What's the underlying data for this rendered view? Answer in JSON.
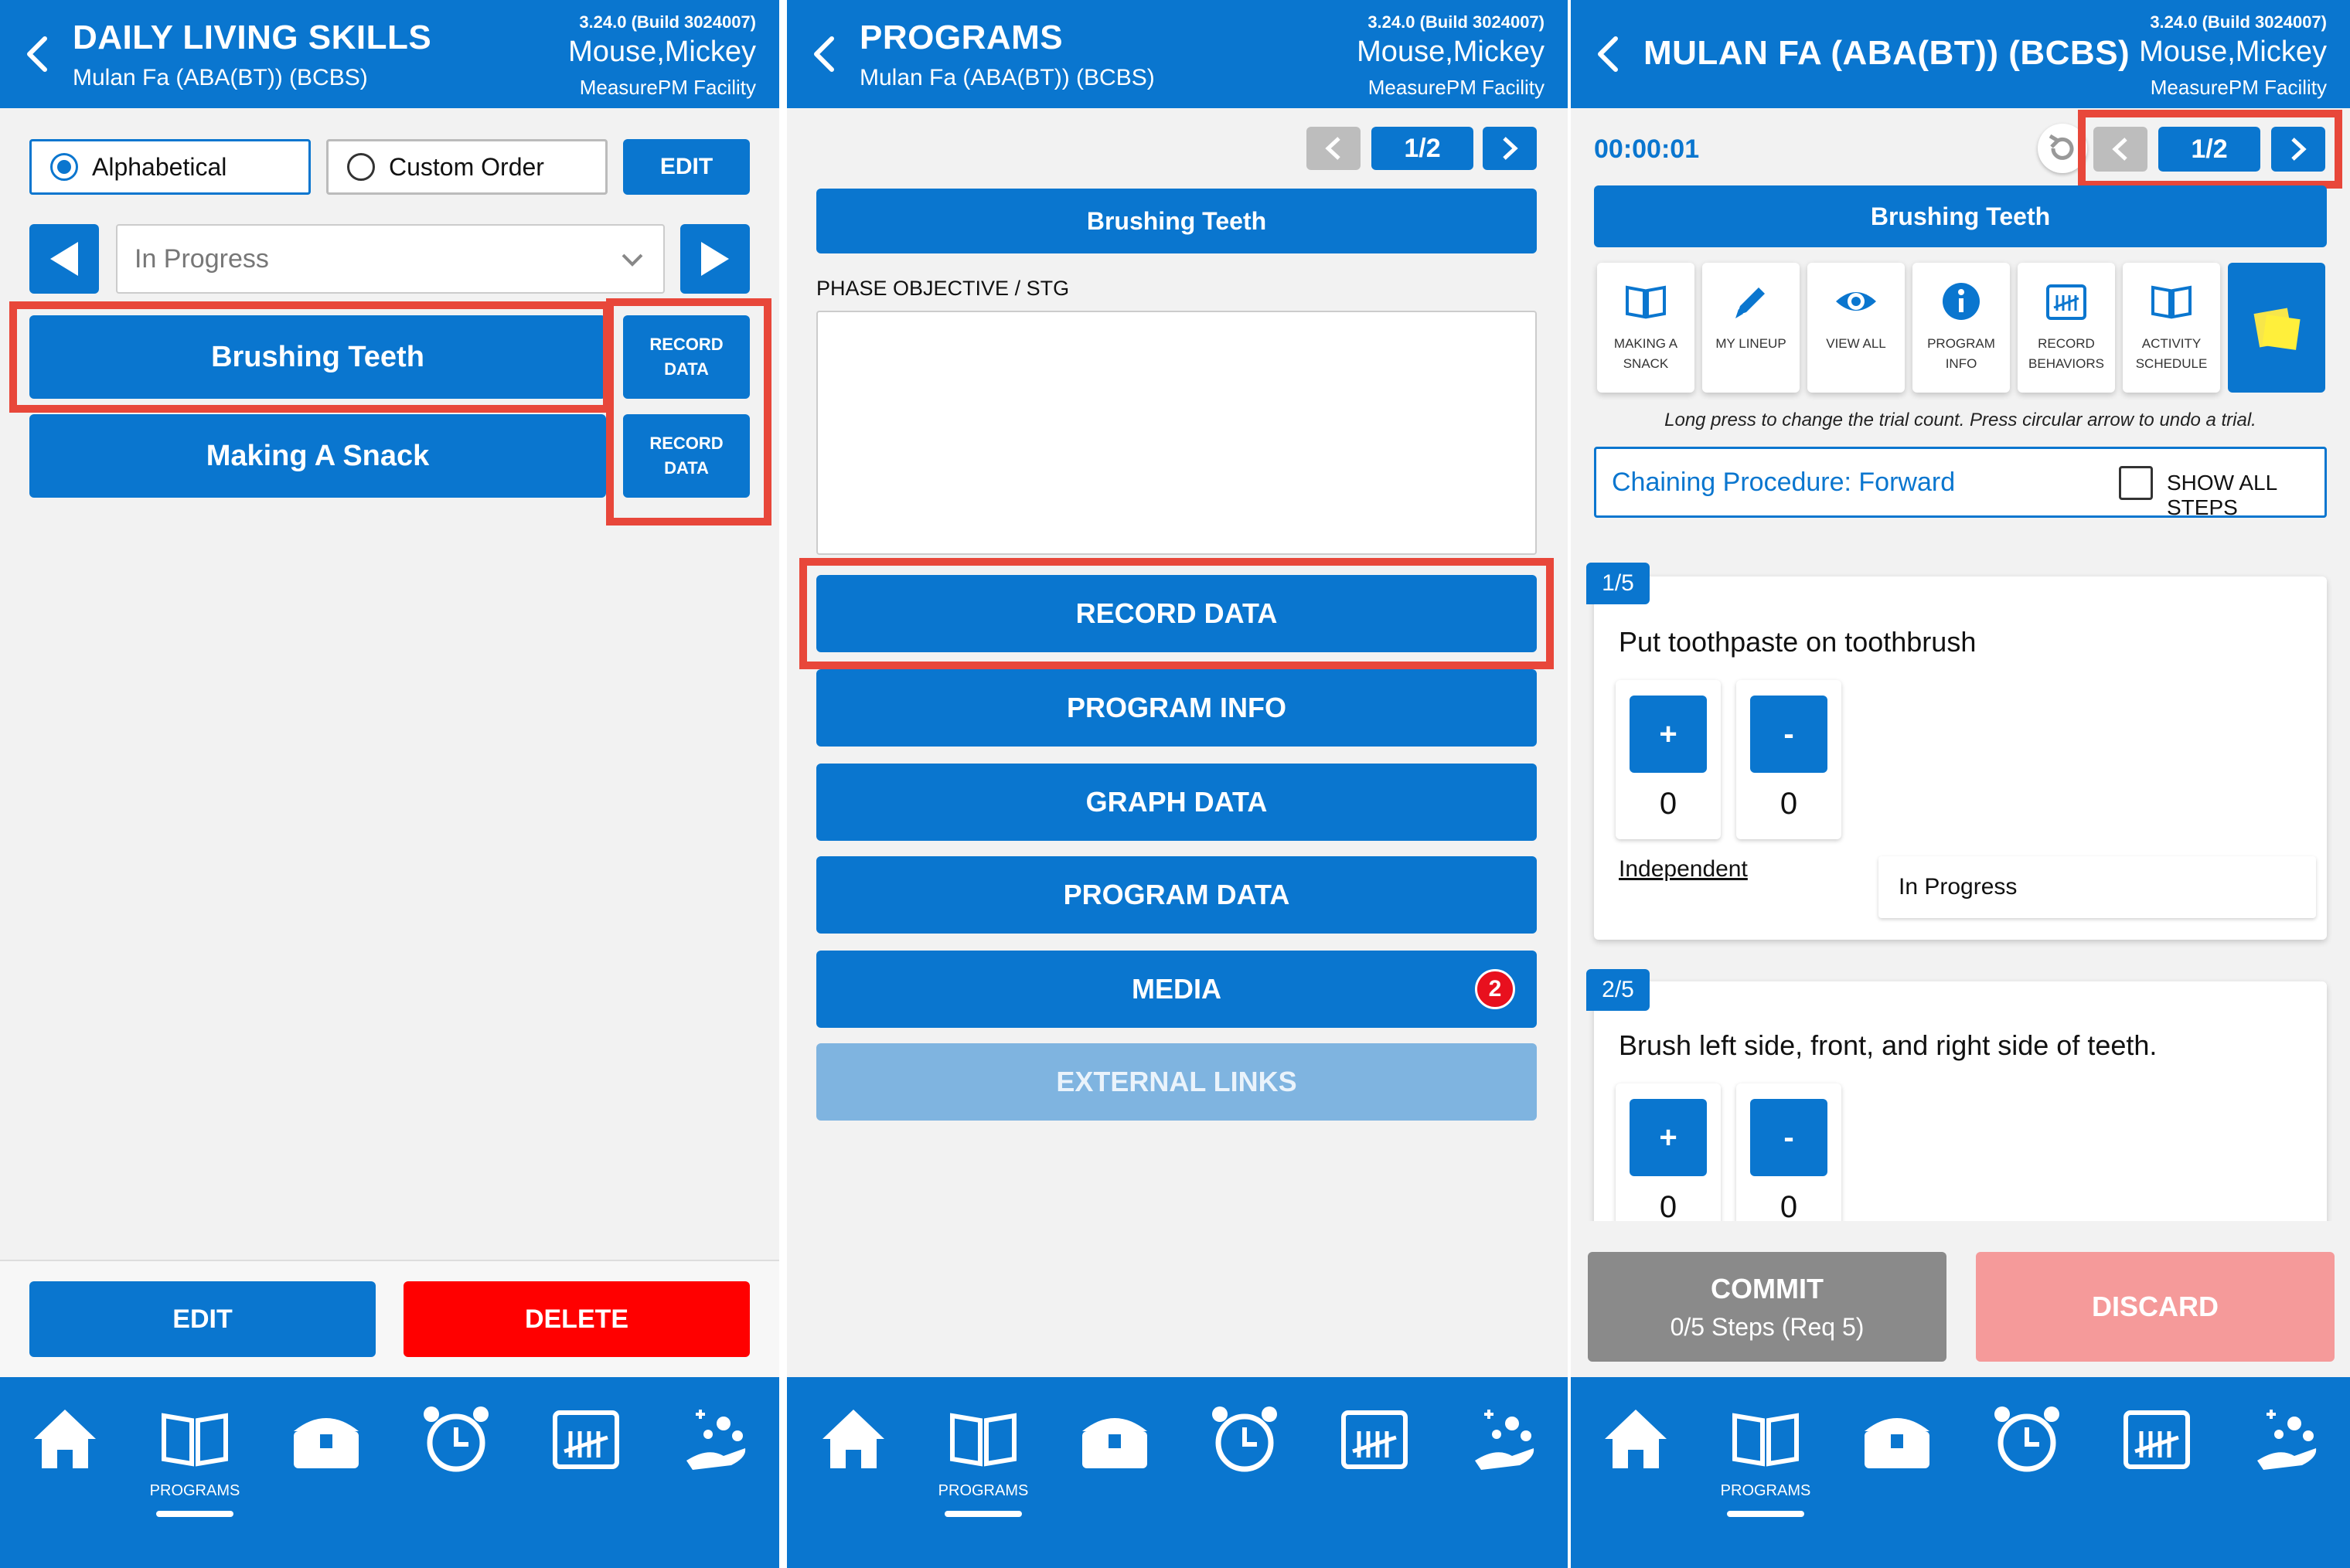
{
  "common": {
    "version": "3.24.0 (Build 3024007)",
    "user": "Mouse,Mickey",
    "facility": "MeasurePM Facility",
    "nav": {
      "home": "",
      "programs": "PROGRAMS",
      "toolbox": "",
      "timer": "",
      "calendar": "",
      "behaviors": ""
    }
  },
  "screen1": {
    "title": "DAILY LIVING SKILLS",
    "subtitle": "Mulan Fa (ABA(BT)) (BCBS)",
    "sort_alphabetical": "Alphabetical",
    "sort_custom": "Custom Order",
    "edit_top": "EDIT",
    "filter_value": "In Progress",
    "programs": [
      {
        "name": "Brushing Teeth",
        "action": "RECORD DATA"
      },
      {
        "name": "Making A Snack",
        "action": "RECORD DATA"
      }
    ],
    "edit_bottom": "EDIT",
    "delete": "DELETE"
  },
  "screen2": {
    "title": "PROGRAMS",
    "subtitle": "Mulan Fa (ABA(BT)) (BCBS)",
    "pager": "1/2",
    "program_name": "Brushing Teeth",
    "phase_label": "PHASE OBJECTIVE / STG",
    "menu": {
      "record": "RECORD DATA",
      "info": "PROGRAM INFO",
      "graph": "GRAPH DATA",
      "data": "PROGRAM DATA",
      "media": "MEDIA",
      "media_badge": "2",
      "links": "EXTERNAL LINKS"
    }
  },
  "screen3": {
    "title": "MULAN FA (ABA(BT)) (BCBS)",
    "timer": "00:00:01",
    "pager": "1/2",
    "program_name": "Brushing Teeth",
    "tools": [
      {
        "label": "MAKING A SNACK",
        "icon": "book-icon"
      },
      {
        "label": "MY LINEUP",
        "icon": "pencil-icon"
      },
      {
        "label": "VIEW ALL",
        "icon": "eye-icon"
      },
      {
        "label": "PROGRAM INFO",
        "icon": "info-icon"
      },
      {
        "label": "RECORD BEHAVIORS",
        "icon": "tally-icon"
      },
      {
        "label": "ACTIVITY SCHEDULE",
        "icon": "book-icon"
      }
    ],
    "hint": "Long press to change the trial count. Press circular arrow to undo a trial.",
    "chaining": "Chaining Procedure: Forward",
    "show_all": "SHOW ALL STEPS",
    "steps": [
      {
        "index": "1/5",
        "text": "Put toothpaste on toothbrush",
        "plus": "+",
        "minus": "-",
        "plus_count": "0",
        "minus_count": "0",
        "prompt": "Independent",
        "status": "In Progress"
      },
      {
        "index": "2/5",
        "text": "Brush left side, front, and right side of teeth.",
        "plus": "+",
        "minus": "-",
        "plus_count": "0",
        "minus_count": "0"
      }
    ],
    "commit_label": "COMMIT",
    "commit_sub": "0/5 Steps (Req 5)",
    "discard": "DISCARD"
  },
  "colors": {
    "primary": "#0a76cf",
    "highlight": "#e8473a",
    "delete": "#ff0000",
    "discard": "#f59a9a",
    "commit": "#8a8a8a",
    "links": "#7fb4e0"
  }
}
